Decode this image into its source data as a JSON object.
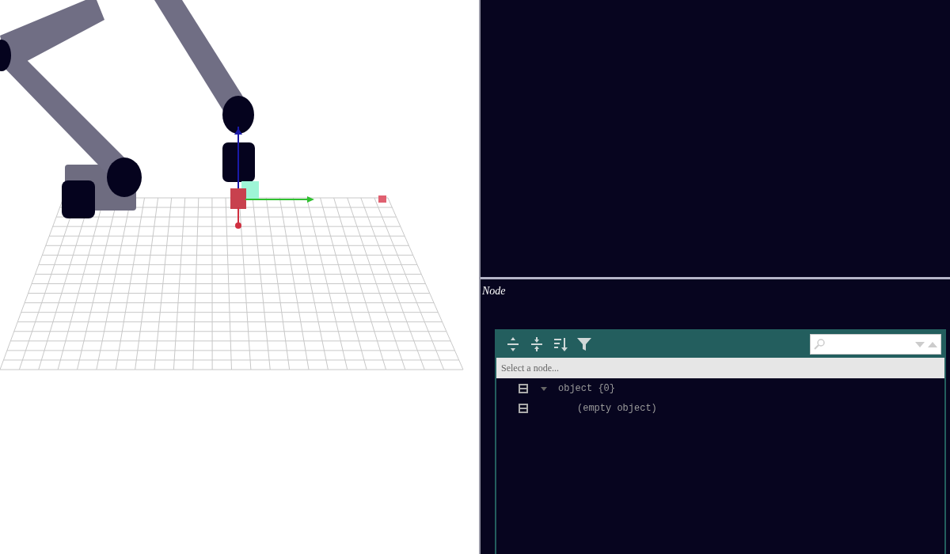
{
  "node_panel": {
    "title": "Node"
  },
  "json_editor": {
    "navigation_bar": "Select a node...",
    "tree": [
      {
        "text": "object {0}",
        "expanded": true,
        "children": [
          {
            "text": "(empty object)"
          }
        ]
      }
    ]
  }
}
